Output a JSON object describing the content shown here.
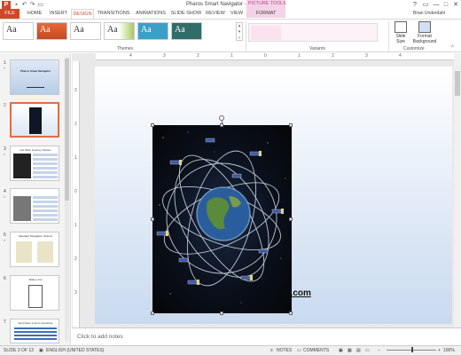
{
  "app": {
    "window_title": "Pharos Smart Navigator - PowerPoint",
    "user_name": "Brian Underdahl",
    "picture_tools_label": "PICTURE TOOLS",
    "logo_letter": "P"
  },
  "qat": {
    "save_icon": "save-icon",
    "undo_icon": "undo-icon",
    "redo_icon": "redo-icon",
    "present_icon": "present-icon"
  },
  "window_controls": [
    "?",
    "▭",
    "—",
    "□",
    "✕"
  ],
  "tabs": [
    {
      "label": "FILE",
      "active": false
    },
    {
      "label": "HOME",
      "active": false
    },
    {
      "label": "INSERT",
      "active": false
    },
    {
      "label": "DESIGN",
      "active": true
    },
    {
      "label": "TRANSITIONS",
      "active": false
    },
    {
      "label": "ANIMATIONS",
      "active": false
    },
    {
      "label": "SLIDE SHOW",
      "active": false
    },
    {
      "label": "REVIEW",
      "active": false
    },
    {
      "label": "VIEW",
      "active": false
    },
    {
      "label": "FORMAT",
      "active": false
    }
  ],
  "ribbon": {
    "themes_group_label": "Themes",
    "variants_group_label": "Variants",
    "customize_group_label": "Customize",
    "theme_thumbnails": [
      {
        "text": "Aa",
        "bg": "#ffffff",
        "fg": "#333333"
      },
      {
        "text": "Aa",
        "bg": "#e8683a",
        "fg": "#ffffff"
      },
      {
        "text": "Aa",
        "bg": "#ffffff",
        "fg": "#333333"
      },
      {
        "text": "Aa",
        "bg": "#a9c95a",
        "fg": "#ffffff"
      },
      {
        "text": "Aa",
        "bg": "#3aa0c8",
        "fg": "#ffffff"
      },
      {
        "text": "Aa",
        "bg": "#2f6d6a",
        "fg": "#ffffff"
      }
    ],
    "slide_size_label": "Slide Size",
    "format_background_label": "Format Background"
  },
  "slides": [
    {
      "number": "1",
      "title": "Pharos Smart Navigator",
      "style": "title",
      "has_star": true
    },
    {
      "number": "2",
      "title": "",
      "style": "picture",
      "selected": true,
      "has_star": false
    },
    {
      "number": "3",
      "title": "Get More Journey Options",
      "style": "dark-list",
      "has_star": true
    },
    {
      "number": "4",
      "title": "",
      "style": "gray-list",
      "has_star": true
    },
    {
      "number": "5",
      "title": "Standard Navigation Options",
      "style": "maps",
      "has_star": true
    },
    {
      "number": "6",
      "title": "Make a trip",
      "style": "flow",
      "has_star": false
    },
    {
      "number": "7",
      "title": "Send them a trip to anywhere",
      "style": "table",
      "has_star": false
    }
  ],
  "ruler": {
    "h_ticks": [
      "4",
      "3",
      "2",
      "1",
      "0",
      "1",
      "2",
      "3",
      "4"
    ],
    "v_ticks": [
      "3",
      "2",
      "1",
      "0",
      "1",
      "2",
      "3"
    ]
  },
  "slide": {
    "picture_alt": "satellites-orbiting-earth-image",
    "text_fragment": "s.com"
  },
  "notes": {
    "placeholder": "Click to add notes"
  },
  "status": {
    "slide_indicator": "SLIDE 2 OF 13",
    "language": "ENGLISH (UNITED STATES)",
    "notes_label": "NOTES",
    "comments_label": "COMMENTS",
    "zoom": "100%"
  }
}
